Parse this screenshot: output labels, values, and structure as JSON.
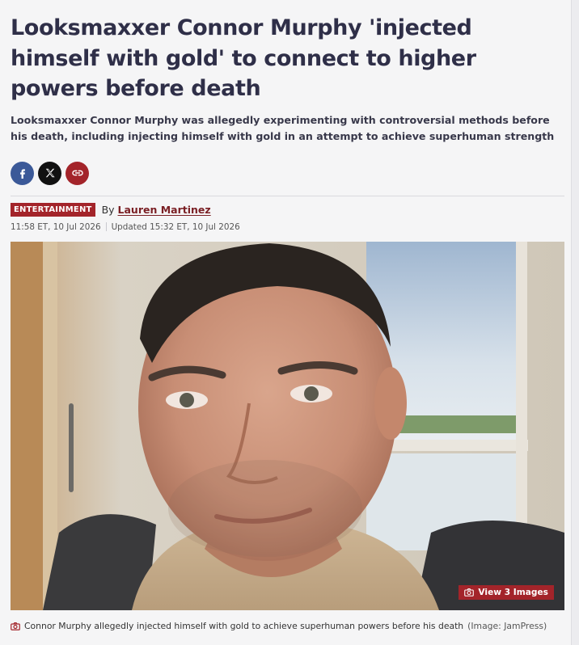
{
  "article": {
    "headline": "Looksmaxxer Connor Murphy 'injected himself with gold' to connect to higher powers before death",
    "standfirst": "Looksmaxxer Connor Murphy was allegedly experimenting with controversial methods before his death, including injecting himself with gold in an attempt to achieve superhuman strength",
    "category": "ENTERTAINMENT",
    "by_label": "By",
    "author": "Lauren Martinez",
    "published": "11:58 ET, 10 Jul 2026",
    "updated": "Updated 15:32 ET, 10 Jul 2026"
  },
  "share": {
    "buttons": [
      {
        "name": "facebook",
        "icon": "facebook-icon",
        "color": "#3b5998"
      },
      {
        "name": "x",
        "icon": "x-icon",
        "color": "#111111"
      },
      {
        "name": "copy-link",
        "icon": "link-icon",
        "color": "#a3242a"
      }
    ]
  },
  "image": {
    "view_images_label": "View 3 Images",
    "caption_text": "Connor Murphy allegedly injected himself with gold to achieve superhuman powers before his death",
    "caption_credit": "(Image: JamPress)"
  },
  "colors": {
    "accent": "#a3242a",
    "headline": "#2f2f48",
    "background": "#f5f5f6"
  }
}
